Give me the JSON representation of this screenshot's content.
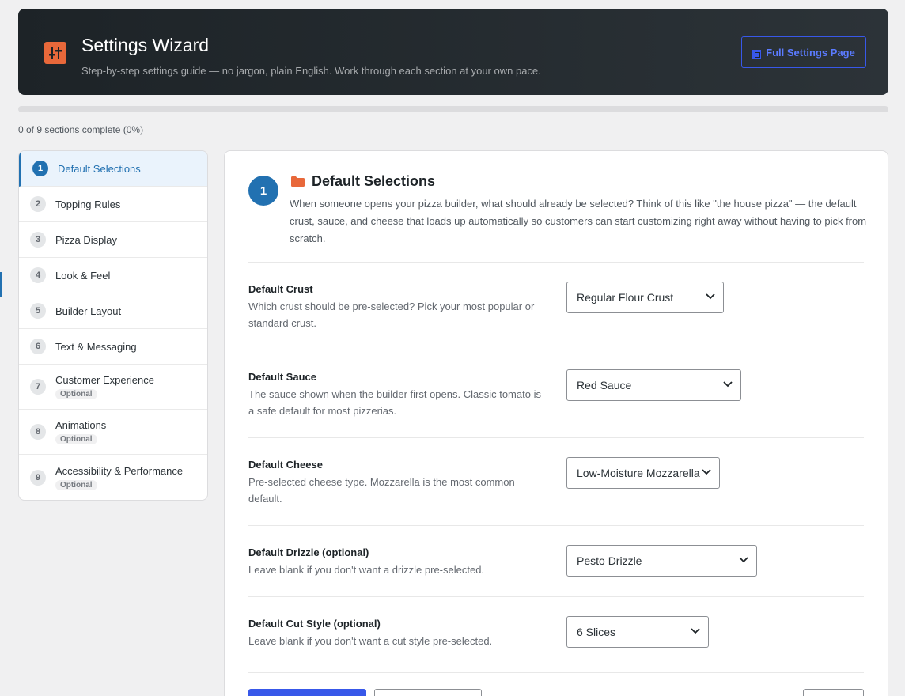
{
  "header": {
    "title": "Settings Wizard",
    "subtitle": "Step-by-step settings guide — no jargon, plain English. Work through each section at your own pace.",
    "full_settings_label": "Full Settings Page"
  },
  "progress": {
    "text": "0 of 9 sections complete (0%)",
    "fraction": 0
  },
  "sidebar": {
    "items": [
      {
        "num": "1",
        "label": "Default Selections",
        "active": true
      },
      {
        "num": "2",
        "label": "Topping Rules"
      },
      {
        "num": "3",
        "label": "Pizza Display"
      },
      {
        "num": "4",
        "label": "Look & Feel"
      },
      {
        "num": "5",
        "label": "Builder Layout"
      },
      {
        "num": "6",
        "label": "Text & Messaging"
      },
      {
        "num": "7",
        "label": "Customer Experience",
        "badge": "Optional"
      },
      {
        "num": "8",
        "label": "Animations",
        "badge": "Optional"
      },
      {
        "num": "9",
        "label": "Accessibility & Performance",
        "badge": "Optional"
      }
    ]
  },
  "section": {
    "number": "1",
    "title": "Default Selections",
    "description": "When someone opens your pizza builder, what should already be selected? Think of this like \"the house pizza\" — the default crust, sauce, and cheese that loads up automatically so customers can start customizing right away without having to pick from scratch."
  },
  "fields": [
    {
      "label": "Default Crust",
      "help": "Which crust should be pre-selected? Pick your most popular or standard crust.",
      "value": "Regular Flour Crust"
    },
    {
      "label": "Default Sauce",
      "help": "The sauce shown when the builder first opens. Classic tomato is a safe default for most pizzerias.",
      "value": "Red Sauce"
    },
    {
      "label": "Default Cheese",
      "help": "Pre-selected cheese type. Mozzarella is the most common default.",
      "value": "Low-Moisture Mozzarella"
    },
    {
      "label": "Default Drizzle (optional)",
      "help": "Leave blank if you don't want a drizzle pre-selected.",
      "value": "Pesto Drizzle"
    },
    {
      "label": "Default Cut Style (optional)",
      "help": "Leave blank if you don't want a cut style pre-selected.",
      "value": "6 Slices"
    }
  ],
  "colors": {
    "accent": "#2271b1",
    "brand_orange": "#e8683a",
    "primary_button": "#3858e9"
  },
  "icons": {
    "header": "settings-sliders-icon",
    "section": "folder-icon",
    "select": "chevron-down-icon"
  }
}
